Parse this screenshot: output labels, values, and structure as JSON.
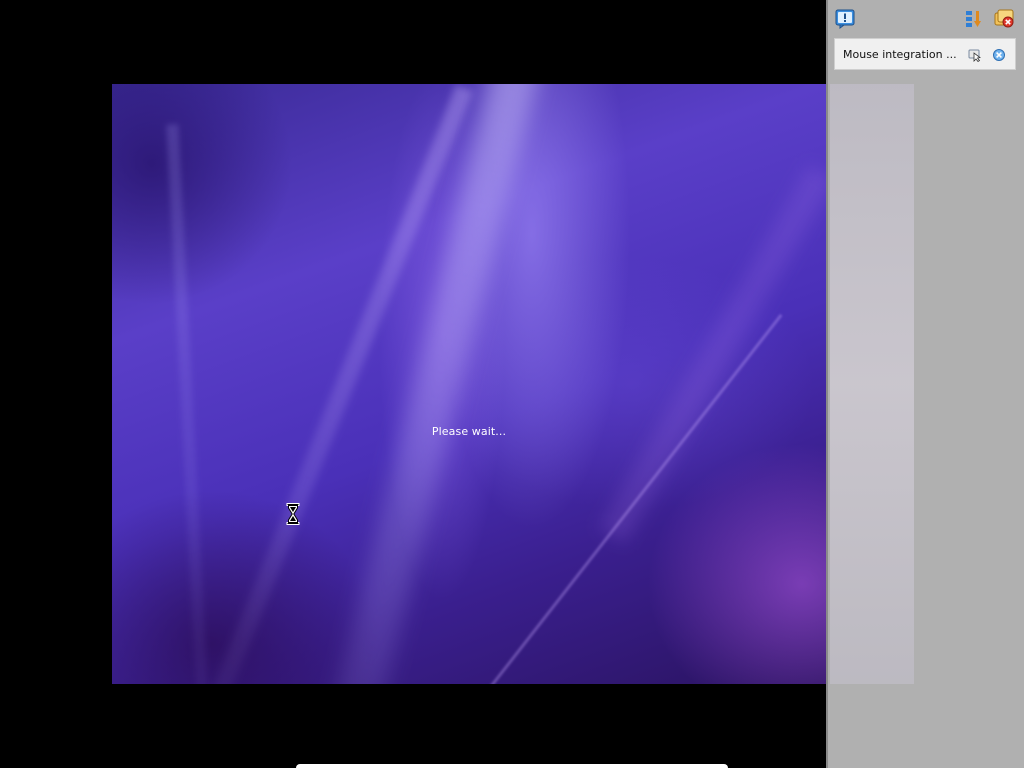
{
  "guest_screen": {
    "status_text": "Please wait...",
    "cursor": "hourglass-busy-icon"
  },
  "notification_panel": {
    "toolbar": {
      "info_icon": "info-bubble-icon",
      "sort_icon": "sort-order-icon",
      "close_all_icon": "close-all-notifications-icon"
    },
    "notifications": [
      {
        "text": "Mouse integration ...",
        "help_icon": "help-pointer-icon",
        "close_icon": "close-icon"
      }
    ]
  },
  "colors": {
    "vm_background": "#000000",
    "panel_background": "#b0b0b0",
    "notification_background": "#f0f0f0",
    "accent_blue": "#2f7fd6"
  }
}
